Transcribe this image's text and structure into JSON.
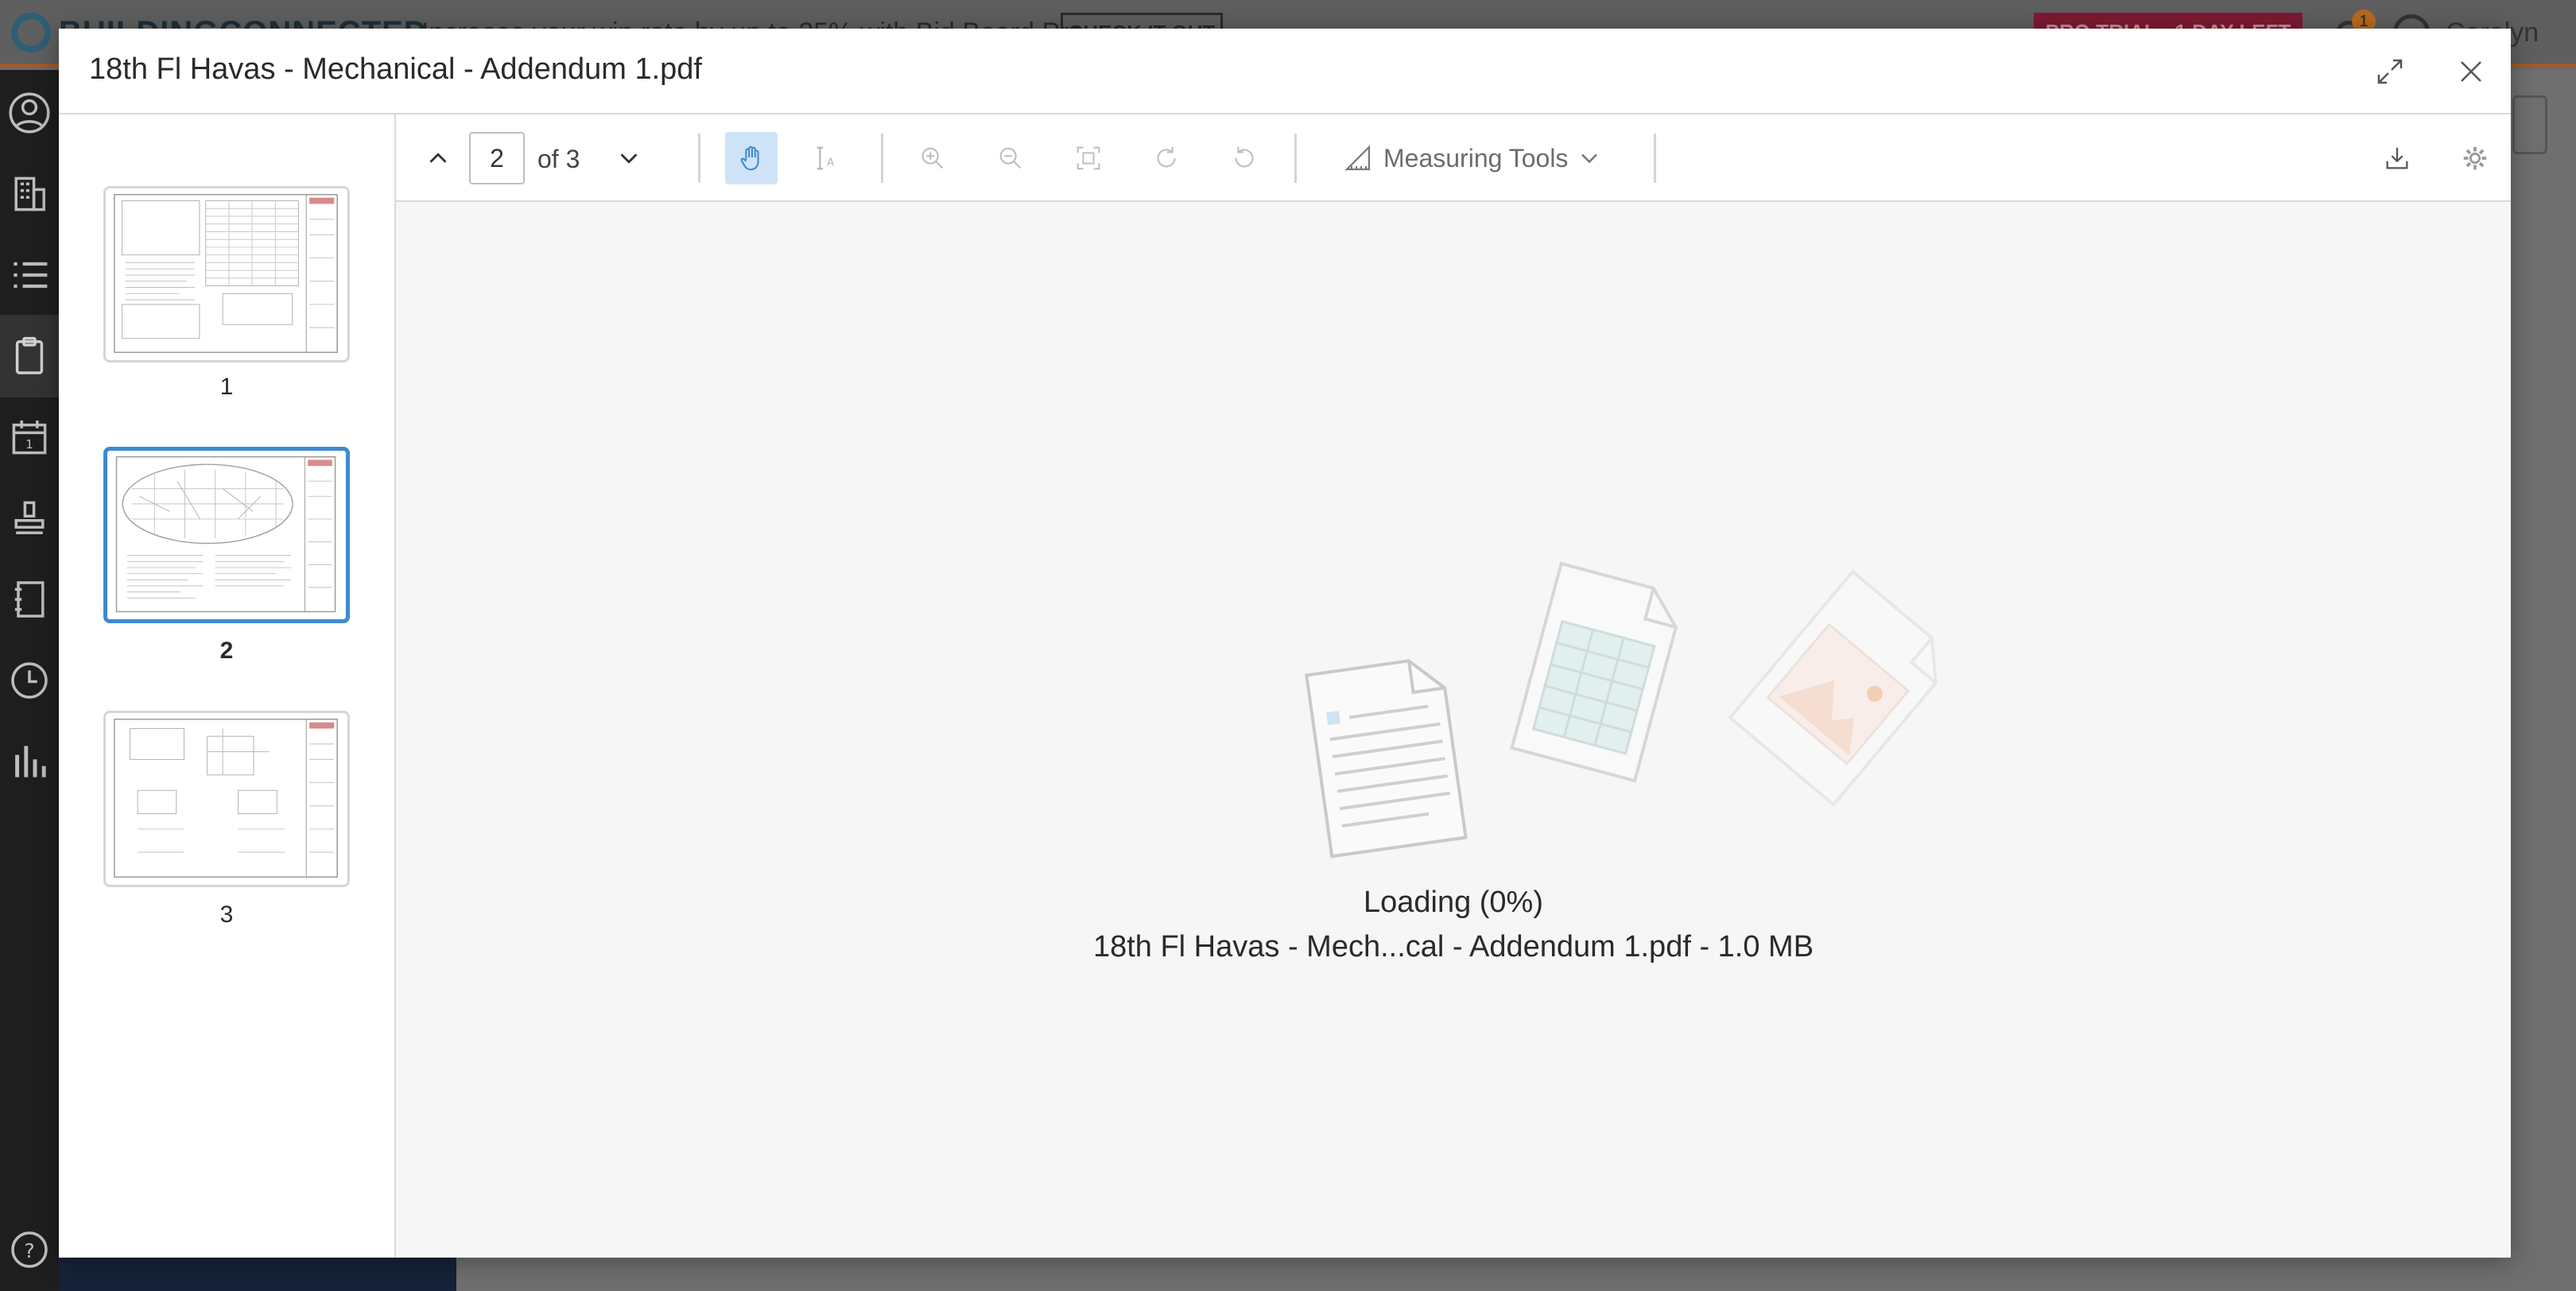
{
  "app": {
    "logo_text": "BUILDINGCONNECTED",
    "promo_text": "Increase your win rate by up to 25% with Bid Board Pro",
    "promo_button": "CHECK IT OUT",
    "trial_badge": "PRO TRIAL - 1 DAY LEFT",
    "notification_count": "1",
    "user_name": "Carolyn",
    "sidebar_icons": [
      "user-icon",
      "building-icon",
      "list-icon",
      "clipboard-icon",
      "calendar-icon",
      "stamp-icon",
      "notebook-icon",
      "clock-icon",
      "bar-chart-icon",
      "help-icon"
    ],
    "sidebar_active": "clipboard-icon"
  },
  "modal": {
    "title": "18th Fl Havas - Mechanical - Addendum 1.pdf"
  },
  "thumbnails": [
    {
      "label": "1",
      "selected": false
    },
    {
      "label": "2",
      "selected": true
    },
    {
      "label": "3",
      "selected": false
    }
  ],
  "toolbar": {
    "page_value": "2",
    "page_of": "of 3",
    "measuring_tools_label": "Measuring Tools",
    "active_tool": "hand-icon"
  },
  "viewer": {
    "loading_status": "Loading (0%)",
    "file_info": "18th Fl Havas - Mech...cal - Addendum 1.pdf - 1.0 MB"
  },
  "colors": {
    "accent": "#3f8ad0",
    "active_tool_bg": "#cfe3f7",
    "trial_badge": "#7d1a33"
  }
}
